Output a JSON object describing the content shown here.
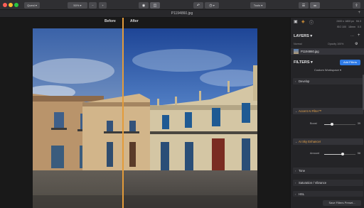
{
  "toolbar": {
    "dropdown_label": "Quest",
    "zoom": "50%",
    "zoom_minus": "−",
    "zoom_plus": "+",
    "tools_label": "Tools"
  },
  "tab": {
    "filename": "P1194860.jpg",
    "add": "+"
  },
  "canvas": {
    "before_label": "Before",
    "after_label": "After"
  },
  "panel": {
    "image_info": {
      "dimensions": "2400 x 1800 px",
      "aperture": "f/6.3",
      "iso": "ISO 100",
      "focal": "18mm",
      "ev": "0.0"
    },
    "layers_title": "LAYERS",
    "blend_mode": "Normal",
    "opacity_label": "Opacity 100%",
    "layer_name": "P1194860.jpg",
    "filters_title": "FILTERS",
    "add_filters": "Add Filters",
    "workspace": "Custom Workspace",
    "filters": [
      {
        "name": "Develop"
      },
      {
        "name": "Accent AI Filter™",
        "slider_label": "Boost",
        "value": "39"
      },
      {
        "name": "AI Sky Enhancer",
        "slider_label": "Amount",
        "value": "58"
      },
      {
        "name": "Tone"
      },
      {
        "name": "Saturation / Vibrance"
      },
      {
        "name": "HSL"
      },
      {
        "name": "Brilliance / Warmth"
      }
    ],
    "save_preset": "Save Filters Preset..."
  },
  "colors": {
    "accent": "#e39b3a",
    "button_blue": "#2f7be6"
  }
}
